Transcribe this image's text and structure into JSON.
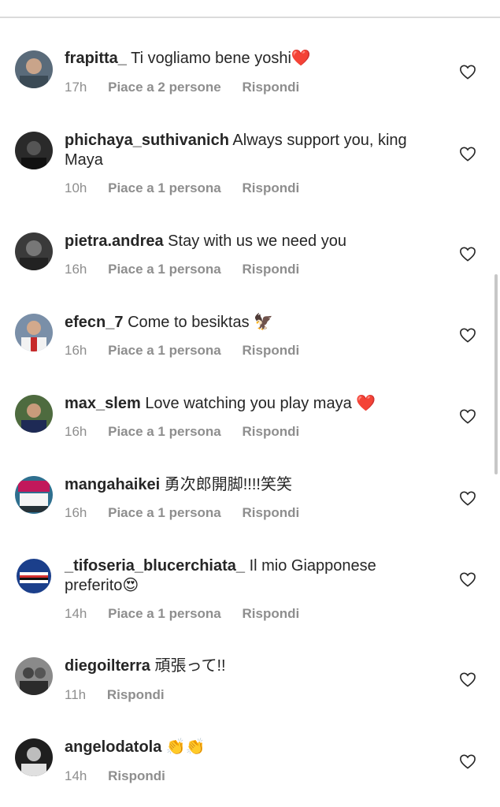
{
  "comments": [
    {
      "username": "frapitta_",
      "text": "Ti vogliamo bene yoshi❤️",
      "time": "17h",
      "likes": "Piace a 2 persone",
      "reply": "Rispondi",
      "avatar_color": "#5a6b7a"
    },
    {
      "username": "phichaya_suthivanich",
      "text": "Always support you, king Maya",
      "time": "10h",
      "likes": "Piace a 1 persona",
      "reply": "Rispondi",
      "avatar_color": "#2a2a2a"
    },
    {
      "username": "pietra.andrea",
      "text": "Stay with us we need you",
      "time": "16h",
      "likes": "Piace a 1 persona",
      "reply": "Rispondi",
      "avatar_color": "#3a3a3a"
    },
    {
      "username": "efecn_7",
      "text": "Come to besiktas 🦅",
      "time": "16h",
      "likes": "Piace a 1 persona",
      "reply": "Rispondi",
      "avatar_color": "#7a8fa8"
    },
    {
      "username": "max_slem",
      "text": "Love watching you play maya ❤️",
      "time": "16h",
      "likes": "Piace a 1 persona",
      "reply": "Rispondi",
      "avatar_color": "#4e6b3f"
    },
    {
      "username": "mangahaikei",
      "text": "勇次郎開脚!!!!笑笑",
      "time": "16h",
      "likes": "Piace a 1 persona",
      "reply": "Rispondi",
      "avatar_color": "#2f6f8f"
    },
    {
      "username": "_tifoseria_blucerchiata_",
      "text": "Il mio Giapponese preferito😍",
      "time": "14h",
      "likes": "Piace a 1 persona",
      "reply": "Rispondi",
      "avatar_color": "#1b3f8b"
    },
    {
      "username": "diegoilterra",
      "text": "頑張って!!",
      "time": "11h",
      "likes": "",
      "reply": "Rispondi",
      "avatar_color": "#6f6f6f"
    },
    {
      "username": "angelodatola",
      "text": "👏👏",
      "time": "14h",
      "likes": "",
      "reply": "Rispondi",
      "avatar_color": "#1f1f1f"
    }
  ],
  "colors": {
    "text": "#262626",
    "meta": "#8e8e8e",
    "divider": "#dbdbdb"
  },
  "icons": {
    "like": "heart-outline-icon"
  }
}
